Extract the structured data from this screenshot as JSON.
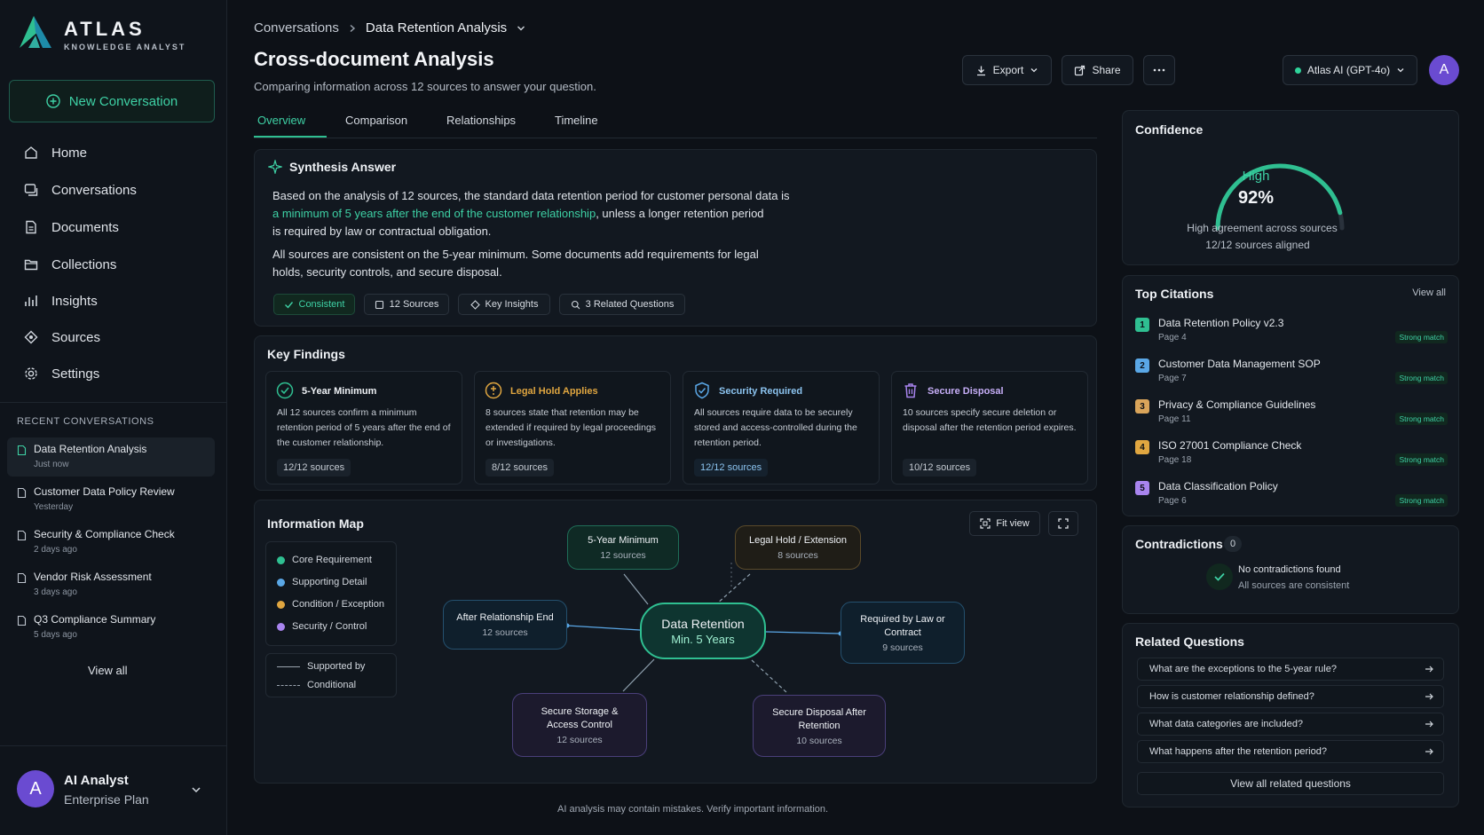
{
  "app": {
    "name": "ATLAS",
    "tagline": "KNOWLEDGE ANALYST"
  },
  "sidebar": {
    "new_conversation": "New Conversation",
    "nav": [
      {
        "label": "Home",
        "icon": "home-icon"
      },
      {
        "label": "Conversations",
        "icon": "chat-icon"
      },
      {
        "label": "Documents",
        "icon": "document-icon"
      },
      {
        "label": "Collections",
        "icon": "folder-icon"
      },
      {
        "label": "Insights",
        "icon": "chart-icon"
      },
      {
        "label": "Sources",
        "icon": "source-icon"
      },
      {
        "label": "Settings",
        "icon": "gear-icon"
      }
    ],
    "recent_label": "RECENT CONVERSATIONS",
    "recent": [
      {
        "title": "Data Retention Analysis",
        "time": "Just now"
      },
      {
        "title": "Customer Data Policy Review",
        "time": "Yesterday"
      },
      {
        "title": "Security & Compliance Check",
        "time": "2 days ago"
      },
      {
        "title": "Vendor Risk Assessment",
        "time": "3 days ago"
      },
      {
        "title": "Q3 Compliance Summary",
        "time": "5 days ago"
      }
    ],
    "view_all": "View all",
    "user": {
      "initial": "A",
      "name": "AI Analyst",
      "plan": "Enterprise Plan"
    }
  },
  "header": {
    "breadcrumb_root": "Conversations",
    "breadcrumb_current": "Data Retention Analysis",
    "title": "Cross-document Analysis",
    "subtitle": "Comparing information across 12 sources to answer your question.",
    "export": "Export",
    "share": "Share",
    "model": "Atlas AI (GPT-4o)",
    "avatar": "A"
  },
  "tabs": [
    "Overview",
    "Comparison",
    "Relationships",
    "Timeline"
  ],
  "synthesis": {
    "title": "Synthesis Answer",
    "p1_a": "Based on the analysis of 12 sources, the standard data retention period for customer personal data is",
    "p1_hl": "a minimum of 5 years after the end of the customer relationship",
    "p1_b": ", unless a longer retention period",
    "p1_c": "is required by law or contractual obligation.",
    "p2_a": "All sources are consistent on the 5-year minimum. Some documents add requirements for legal",
    "p2_b": "holds, security controls, and secure disposal.",
    "chips": [
      "Consistent",
      "12 Sources",
      "Key Insights",
      "3 Related Questions"
    ]
  },
  "findings": {
    "title": "Key Findings",
    "items": [
      {
        "title": "5-Year Minimum",
        "body": "All 12 sources confirm a minimum retention period of 5 years after the end of the customer relationship.",
        "badge": "12/12 sources",
        "color": "#2fbf91"
      },
      {
        "title": "Legal Hold Applies",
        "body": "8 sources state that retention may be extended if required by legal proceedings or investigations.",
        "badge": "8/12 sources",
        "color": "#e0a640"
      },
      {
        "title": "Security Required",
        "body": "All sources require data to be securely stored and access-controlled during the retention period.",
        "badge": "12/12 sources",
        "color": "#5aa7e6"
      },
      {
        "title": "Secure Disposal",
        "body": "10 sources specify secure deletion or disposal after the retention period expires.",
        "badge": "10/12 sources",
        "color": "#a884ee"
      }
    ]
  },
  "map": {
    "title": "Information Map",
    "fit_view": "Fit view",
    "legend": [
      {
        "label": "Core Requirement",
        "color": "#2fbf91"
      },
      {
        "label": "Supporting Detail",
        "color": "#5aa7e6"
      },
      {
        "label": "Condition / Exception",
        "color": "#e0a640"
      },
      {
        "label": "Security / Control",
        "color": "#a884ee"
      }
    ],
    "legend_lines": [
      "Supported by",
      "Conditional"
    ],
    "center": {
      "title": "Data Retention",
      "sub": "Min. 5 Years"
    },
    "nodes": {
      "five_year": {
        "title": "5-Year Minimum",
        "sub": "12 sources"
      },
      "legal_hold": {
        "title": "Legal Hold / Extension",
        "sub": "8 sources"
      },
      "after_end": {
        "title": "After Relationship End",
        "sub": "12 sources"
      },
      "required_law": {
        "title": "Required by Law or Contract",
        "sub": "9 sources"
      },
      "secure_storage": {
        "title": "Secure Storage & Access Control",
        "sub": "12 sources"
      },
      "secure_disposal": {
        "title": "Secure Disposal After Retention",
        "sub": "10 sources"
      }
    }
  },
  "footer": "AI analysis may contain mistakes. Verify important information.",
  "confidence": {
    "title": "Confidence",
    "level": "High",
    "value": "92%",
    "fraction": 0.92,
    "note1": "High agreement across sources",
    "note2": "12/12 sources aligned"
  },
  "citations": {
    "title": "Top Citations",
    "view_all": "View all",
    "items": [
      {
        "n": "1",
        "title": "Data Retention Policy v2.3",
        "page": "Page 4",
        "match": "Strong match",
        "color": "#2fbf91"
      },
      {
        "n": "2",
        "title": "Customer Data Management SOP",
        "page": "Page 7",
        "match": "Strong match",
        "color": "#5aa7e6"
      },
      {
        "n": "3",
        "title": "Privacy & Compliance Guidelines",
        "page": "Page 11",
        "match": "Strong match",
        "color": "#d9a45a"
      },
      {
        "n": "4",
        "title": "ISO 27001 Compliance Check",
        "page": "Page 18",
        "match": "Strong match",
        "color": "#e0a640"
      },
      {
        "n": "5",
        "title": "Data Classification Policy",
        "page": "Page 6",
        "match": "Strong match",
        "color": "#a884ee"
      }
    ]
  },
  "contradictions": {
    "title": "Contradictions",
    "count": "0",
    "none": "No contradictions found",
    "consistent": "All sources are consistent"
  },
  "related": {
    "title": "Related Questions",
    "items": [
      "What are the exceptions to the 5-year rule?",
      "How is customer relationship defined?",
      "What data categories are included?",
      "What happens after the retention period?"
    ],
    "view_all": "View all related questions"
  }
}
